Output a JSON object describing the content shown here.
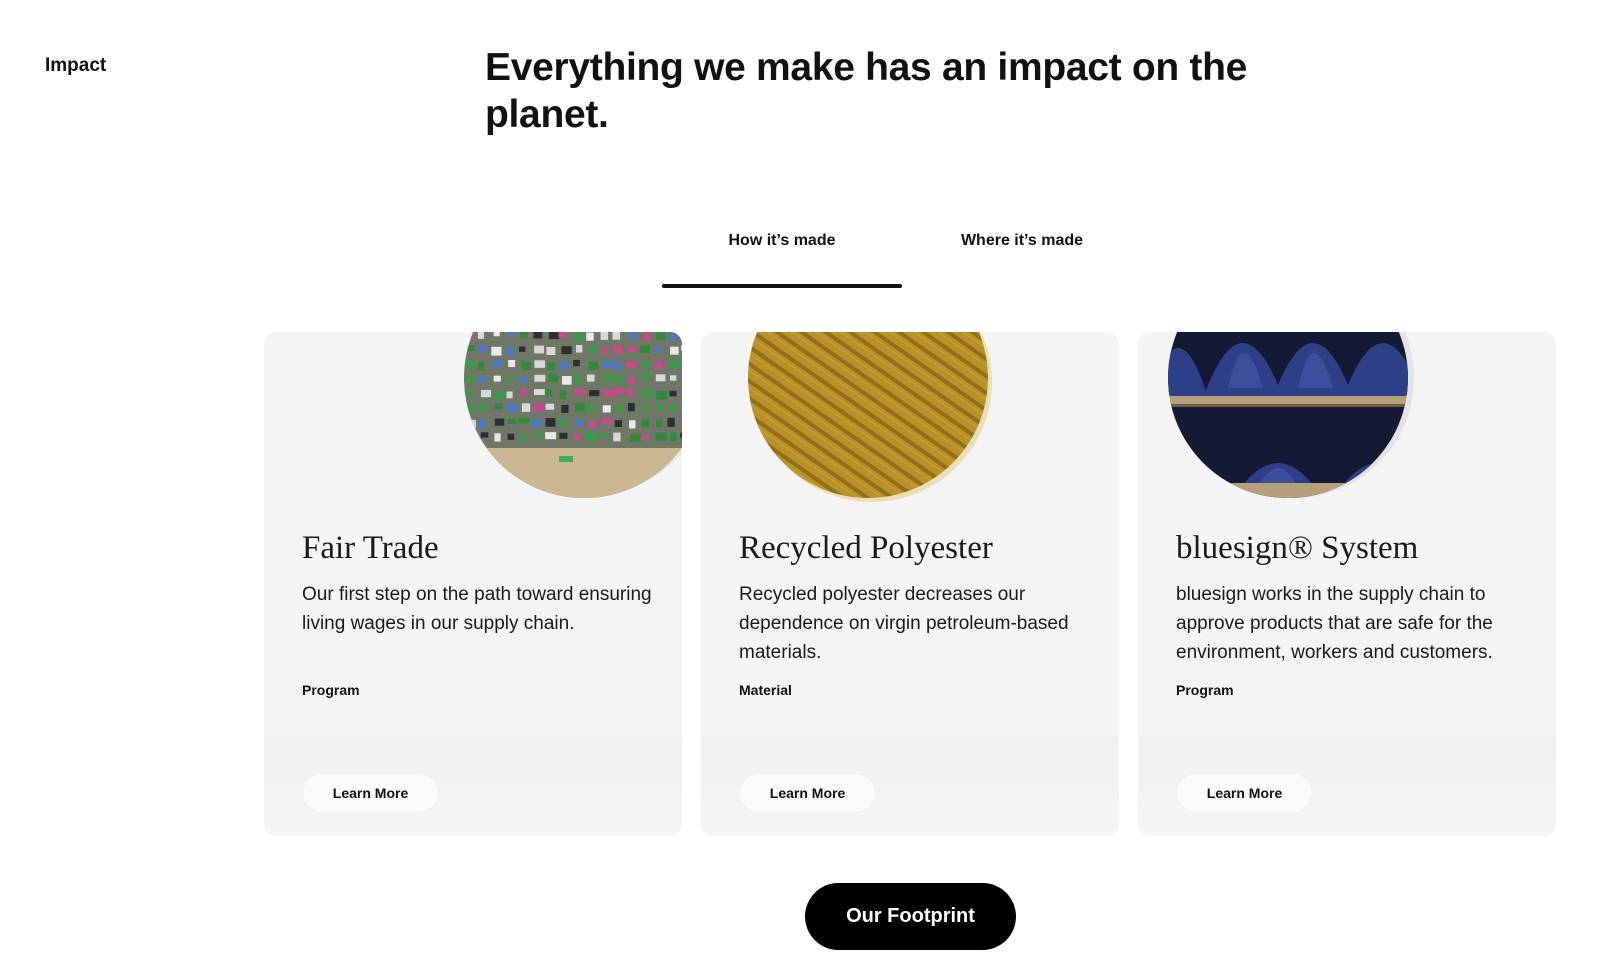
{
  "section_label": "Impact",
  "headline": "Everything we make has an impact on the planet.",
  "tabs": [
    {
      "label": "How it’s made",
      "active": true
    },
    {
      "label": "Where it’s made",
      "active": false
    }
  ],
  "cards": [
    {
      "title": "Fair Trade",
      "description": "Our first step on the path toward ensuring living wages in our supply chain.",
      "tag": "Program",
      "button": "Learn More",
      "image": "factory-workers-photo"
    },
    {
      "title": "Recycled Polyester",
      "description": "Recycled polyester decreases our dependence on virgin petroleum-based materials.",
      "tag": "Material",
      "button": "Learn More",
      "image": "yellow-fabric-photo"
    },
    {
      "title": "bluesign® System",
      "description": "bluesign works in the supply chain to approve products that are safe for the environment, workers and customers.",
      "tag": "Program",
      "button": "Learn More",
      "image": "blue-yarn-spools-photo"
    }
  ],
  "footer_button": "Our Footprint",
  "colors": {
    "text": "#111111",
    "card_background": "#f4f4f4",
    "primary_button": "#000000"
  }
}
